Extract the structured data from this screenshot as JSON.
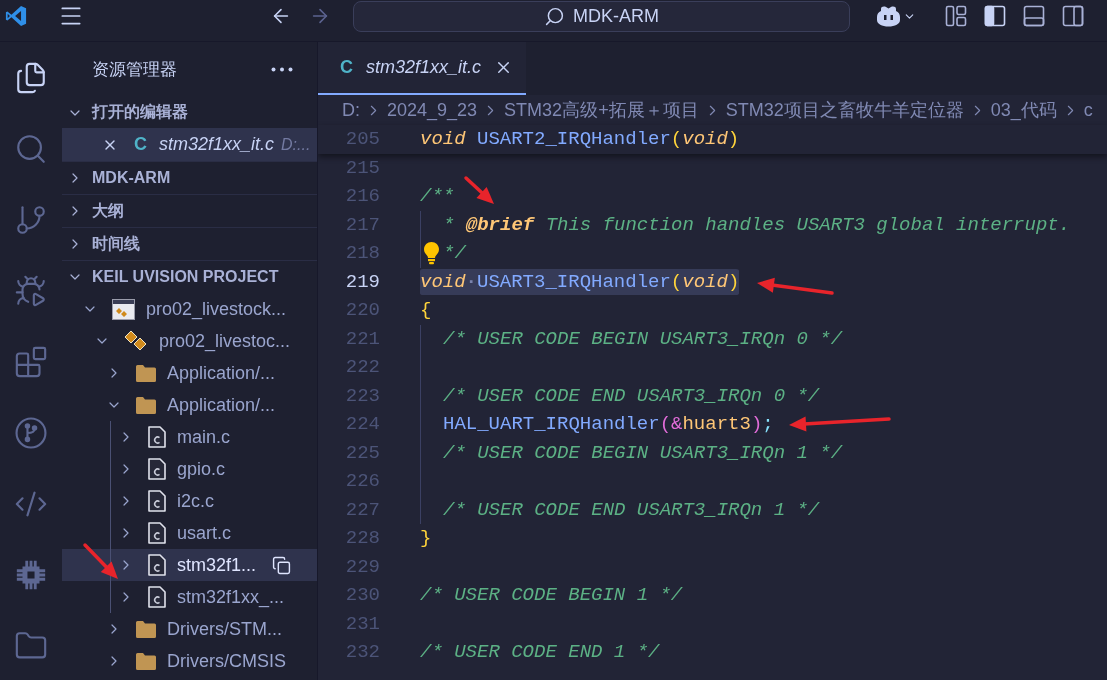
{
  "title_bar": {
    "navigation": [
      {
        "kind": "back",
        "disabled": false
      },
      {
        "kind": "forward",
        "disabled": true
      }
    ],
    "command_center": "MDK-ARM",
    "layout_toggles": [
      {
        "kind": "customize_layout",
        "on": false
      },
      {
        "kind": "primary_sidebar",
        "on": true
      },
      {
        "kind": "panel",
        "on": false
      },
      {
        "kind": "secondary_sidebar",
        "on": false
      }
    ]
  },
  "activity_bar": [
    {
      "kind": "explorer",
      "selected": true
    },
    {
      "kind": "search",
      "selected": false
    },
    {
      "kind": "source_control",
      "selected": false
    },
    {
      "kind": "run_debug",
      "selected": false
    },
    {
      "kind": "extensions",
      "selected": false
    },
    {
      "kind": "git_graph",
      "selected": false
    },
    {
      "kind": "remote",
      "selected": false
    },
    {
      "kind": "chip",
      "selected": false
    },
    {
      "kind": "folders",
      "selected": false
    }
  ],
  "sidebar": {
    "title": "资源管理器",
    "sections": [
      {
        "kind": "open_editors",
        "title": "打开的编辑器",
        "expanded": true,
        "items": [
          {
            "icon": "C",
            "name": "stm32f1xx_it.c",
            "path": "D:...",
            "preview": true,
            "selected": true
          }
        ]
      },
      {
        "kind": "view",
        "title": "MDK-ARM",
        "expanded": false
      },
      {
        "kind": "view",
        "title": "大纲",
        "expanded": false
      },
      {
        "kind": "view",
        "title": "时间线",
        "expanded": false
      },
      {
        "kind": "tree",
        "title": "KEIL UVISION PROJECT",
        "expanded": true,
        "tree": [
          {
            "kind": "project",
            "name": "pro02_livestock...",
            "expanded": true,
            "selected": false,
            "children": [
              {
                "kind": "target",
                "name": "pro02_livestoc...",
                "expanded": true,
                "selected": false,
                "children": [
                  {
                    "kind": "folder",
                    "name": "Application/...",
                    "expanded": false,
                    "selected": false
                  },
                  {
                    "kind": "folder",
                    "name": "Application/...",
                    "expanded": true,
                    "selected": false,
                    "children": [
                      {
                        "kind": "file",
                        "name": "main.c",
                        "expanded": false,
                        "selected": false
                      },
                      {
                        "kind": "file",
                        "name": "gpio.c",
                        "expanded": false,
                        "selected": false
                      },
                      {
                        "kind": "file",
                        "name": "i2c.c",
                        "expanded": false,
                        "selected": false
                      },
                      {
                        "kind": "file",
                        "name": "usart.c",
                        "expanded": false,
                        "selected": false
                      },
                      {
                        "kind": "file",
                        "name": "stm32f1...",
                        "expanded": false,
                        "selected": true
                      },
                      {
                        "kind": "file",
                        "name": "stm32f1xx_...",
                        "expanded": false,
                        "selected": false
                      }
                    ]
                  },
                  {
                    "kind": "folder",
                    "name": "Drivers/STM...",
                    "expanded": false,
                    "selected": false
                  },
                  {
                    "kind": "folder",
                    "name": "Drivers/CMSIS",
                    "expanded": false,
                    "selected": false
                  }
                ]
              }
            ]
          }
        ]
      }
    ]
  },
  "editor": {
    "tabs": [
      {
        "icon": "C",
        "title": "stm32f1xx_it.c",
        "preview": true,
        "selected": true
      }
    ],
    "breadcrumb": [
      "D:",
      "2024_9_23",
      "STM32高级+拓展＋项目",
      "STM32项目之畜牧牛羊定位器",
      "03_代码",
      "c"
    ],
    "sticky_line": {
      "number": "205",
      "tokens": [
        {
          "text": "void",
          "kind": "keyword"
        },
        {
          "text": " USART2_IRQHandler",
          "kind": "function"
        },
        {
          "text": "(",
          "kind": "bracket"
        },
        {
          "text": "void",
          "kind": "keyword"
        },
        {
          "text": ")",
          "kind": "bracket"
        }
      ]
    },
    "lines": [
      {
        "number": "215",
        "indented": false,
        "current": false,
        "lightbulb": false
      },
      {
        "number": "216",
        "tokens": [
          {
            "text": "/**",
            "kind": "comment"
          }
        ],
        "indented": false,
        "current": false,
        "lightbulb": false
      },
      {
        "number": "217",
        "tokens": [
          {
            "text": "* ",
            "kind": "comment"
          },
          {
            "text": "@brief",
            "kind": "doc_tag"
          },
          {
            "text": " This function handles USART3 global interrupt.",
            "kind": "comment"
          }
        ],
        "indented": true,
        "current": false,
        "lightbulb": false
      },
      {
        "number": "218",
        "tokens": [
          {
            "text": "*/",
            "kind": "comment"
          }
        ],
        "indented": true,
        "current": false,
        "lightbulb": true
      },
      {
        "number": "219",
        "tokens": [
          {
            "text": "void",
            "kind": "keyword"
          },
          {
            "text": "·",
            "kind": "whitespace"
          },
          {
            "text": "USART3_IRQHandler",
            "kind": "function"
          },
          {
            "text": "(",
            "kind": "bracket"
          },
          {
            "text": "void",
            "kind": "keyword"
          },
          {
            "text": ")",
            "kind": "bracket"
          }
        ],
        "indented": false,
        "current": true,
        "lightbulb": false
      },
      {
        "number": "220",
        "tokens": [
          {
            "text": "{",
            "kind": "bracket"
          }
        ],
        "indented": false,
        "current": false,
        "lightbulb": false
      },
      {
        "number": "221",
        "tokens": [
          {
            "text": "/* USER CODE BEGIN USART3_IRQn 0 */",
            "kind": "comment"
          }
        ],
        "indented": true,
        "current": false,
        "lightbulb": false
      },
      {
        "number": "222",
        "indented": true,
        "current": false,
        "lightbulb": false
      },
      {
        "number": "223",
        "tokens": [
          {
            "text": "/* USER CODE END USART3_IRQn 0 */",
            "kind": "comment"
          }
        ],
        "indented": true,
        "current": false,
        "lightbulb": false
      },
      {
        "number": "224",
        "tokens": [
          {
            "text": "HAL_UART_IRQHandler",
            "kind": "function"
          },
          {
            "text": "(",
            "kind": "bracket2"
          },
          {
            "text": "&",
            "kind": "operator"
          },
          {
            "text": "huart3",
            "kind": "variable"
          },
          {
            "text": ")",
            "kind": "bracket2"
          },
          {
            "text": ";",
            "kind": "punctuation"
          }
        ],
        "indented": true,
        "current": false,
        "lightbulb": false
      },
      {
        "number": "225",
        "tokens": [
          {
            "text": "/* USER CODE BEGIN USART3_IRQn 1 */",
            "kind": "comment"
          }
        ],
        "indented": true,
        "current": false,
        "lightbulb": false
      },
      {
        "number": "226",
        "indented": true,
        "current": false,
        "lightbulb": false
      },
      {
        "number": "227",
        "tokens": [
          {
            "text": "/* USER CODE END USART3_IRQn 1 */",
            "kind": "comment"
          }
        ],
        "indented": true,
        "current": false,
        "lightbulb": false
      },
      {
        "number": "228",
        "tokens": [
          {
            "text": "}",
            "kind": "bracket"
          }
        ],
        "indented": false,
        "current": false,
        "lightbulb": false
      },
      {
        "number": "229",
        "indented": false,
        "current": false,
        "lightbulb": false
      },
      {
        "number": "230",
        "tokens": [
          {
            "text": "/* USER CODE BEGIN 1 */",
            "kind": "comment"
          }
        ],
        "indented": false,
        "current": false,
        "lightbulb": false
      },
      {
        "number": "231",
        "indented": false,
        "current": false,
        "lightbulb": false
      },
      {
        "number": "232",
        "tokens": [
          {
            "text": "/* USER CODE END 1 */",
            "kind": "comment"
          }
        ],
        "indented": false,
        "current": false,
        "lightbulb": false
      }
    ]
  }
}
